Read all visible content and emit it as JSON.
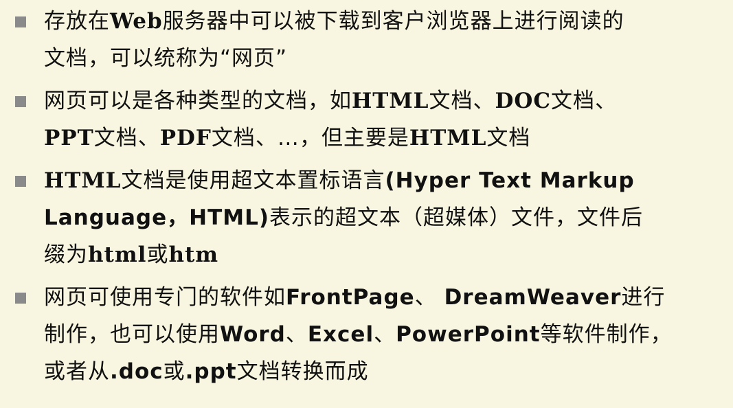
{
  "slide": {
    "bullets": [
      {
        "lines": [
          [
            {
              "text": "存放在"
            },
            {
              "text": "Web",
              "bold": true,
              "serif": true
            },
            {
              "text": "服务器中可以被下载到客户浏览器上进行阅读的"
            }
          ],
          [
            {
              "text": "文档，可以统称为“网页”"
            }
          ]
        ]
      },
      {
        "lines": [
          [
            {
              "text": "网页可以是各种类型的文档，如"
            },
            {
              "text": "HTML",
              "bold": true,
              "serif": true
            },
            {
              "text": "文档、"
            },
            {
              "text": "DOC",
              "bold": true,
              "serif": true
            },
            {
              "text": "文档、"
            }
          ],
          [
            {
              "text": "PPT",
              "bold": true,
              "serif": true
            },
            {
              "text": "文档、"
            },
            {
              "text": "PDF",
              "bold": true,
              "serif": true
            },
            {
              "text": "文档、…，但主要是"
            },
            {
              "text": "HTML",
              "bold": true,
              "serif": true
            },
            {
              "text": "文档"
            }
          ]
        ]
      },
      {
        "lines": [
          [
            {
              "text": "HTML",
              "bold": true,
              "serif": true
            },
            {
              "text": "文档是使用超文本置标语言"
            },
            {
              "text": "(Hyper Text Markup",
              "bold": true,
              "sans": true
            }
          ],
          [
            {
              "text": "Language，HTML)",
              "bold": true,
              "sans": true
            },
            {
              "text": "表示的超文本（超媒体）文件，文件后"
            }
          ],
          [
            {
              "text": "缀为"
            },
            {
              "text": "html",
              "bold": true,
              "serif": true
            },
            {
              "text": "或"
            },
            {
              "text": "htm",
              "bold": true,
              "serif": true
            }
          ]
        ]
      },
      {
        "lines": [
          [
            {
              "text": "网页可使用专门的软件如"
            },
            {
              "text": "FrontPage",
              "bold": true,
              "sans": true
            },
            {
              "text": "、 "
            },
            {
              "text": "DreamWeaver",
              "bold": true,
              "sans": true
            },
            {
              "text": "进行"
            }
          ],
          [
            {
              "text": "制作，也可以使用"
            },
            {
              "text": "Word",
              "bold": true,
              "sans": true
            },
            {
              "text": "、"
            },
            {
              "text": "Excel",
              "bold": true,
              "sans": true
            },
            {
              "text": "、"
            },
            {
              "text": "PowerPoint",
              "bold": true,
              "sans": true
            },
            {
              "text": "等软件制作，"
            }
          ],
          [
            {
              "text": "或者从"
            },
            {
              "text": ".doc",
              "bold": true,
              "sans": true
            },
            {
              "text": "或"
            },
            {
              "text": ".ppt",
              "bold": true,
              "sans": true
            },
            {
              "text": "文档转换而成"
            }
          ]
        ]
      }
    ]
  }
}
